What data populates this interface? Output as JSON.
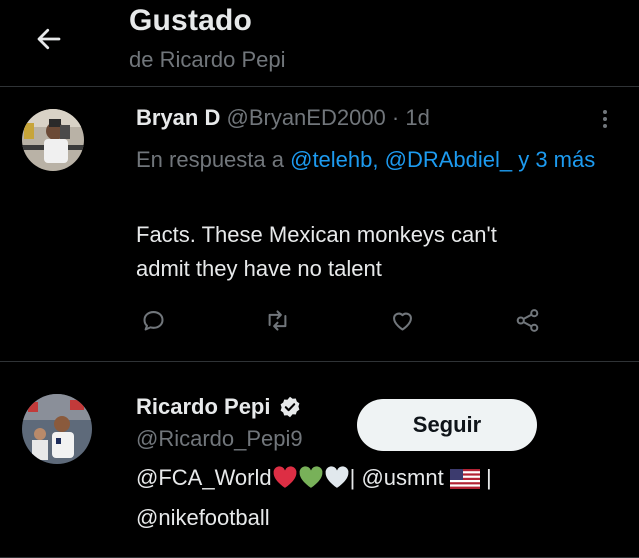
{
  "header": {
    "title": "Gustado",
    "subtitle": "de Ricardo Pepi"
  },
  "tweet": {
    "name": "Bryan D",
    "handle": "@BryanED2000",
    "separator": "·",
    "time": "1d",
    "reply_prefix": "En respuesta a",
    "reply_mentions": "@telehb, @DRAbdiel_ y 3 más",
    "text_line1": "Facts. These Mexican monkeys can't",
    "text_line2": "admit they have no talent"
  },
  "user": {
    "name": "Ricardo Pepi",
    "handle": "@Ricardo_Pepi9",
    "follow_label": "Seguir",
    "bio_mention1": "@FCA_World",
    "bio_sep1": "|",
    "bio_mention2": "@usmnt",
    "bio_sep2": "|",
    "bio_mention3": "@nikefootball"
  },
  "icons": {
    "back": "arrow-left-icon",
    "more": "more-vertical-icon",
    "reply": "reply-icon",
    "retweet": "retweet-icon",
    "like": "heart-icon",
    "share": "share-icon",
    "verified": "verified-badge-icon"
  },
  "colors": {
    "background": "#000000",
    "text_primary": "#e7e9ea",
    "text_secondary": "#71767b",
    "link": "#1d9bf0",
    "divider": "#2f3336",
    "follow_button_bg": "#eff3f4",
    "follow_button_text": "#0f1419"
  }
}
